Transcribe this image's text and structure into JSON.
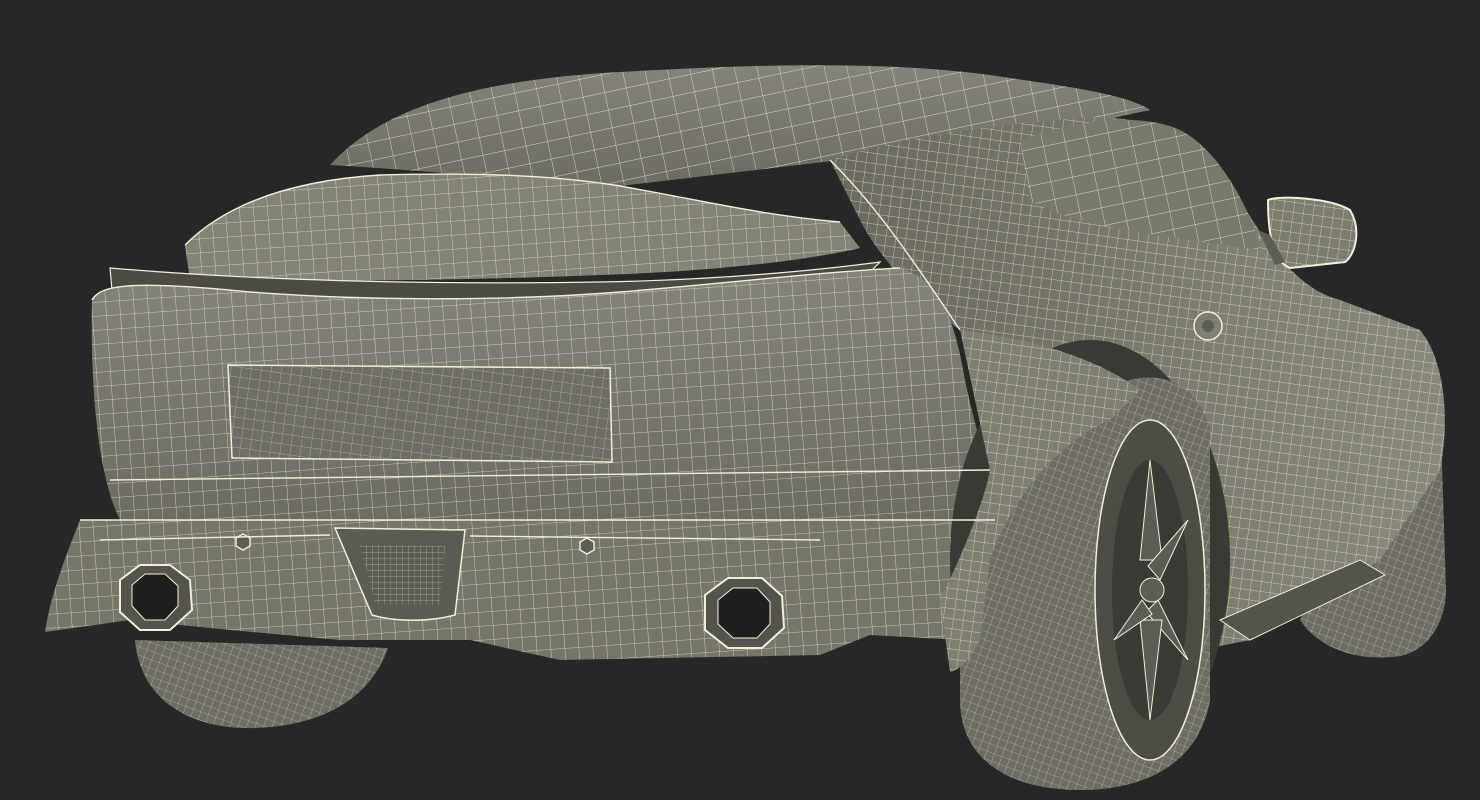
{
  "scene": {
    "subject": "wireframe-sports-car-rear-three-quarter",
    "colors": {
      "background": "#272727",
      "surface": "#7d7c70",
      "surface_dark": "#5e5d54",
      "surface_light": "#8c8b7f",
      "wire": "#f2efd8",
      "shadow": "#2a2a27",
      "tire": "#6e6d63"
    }
  }
}
